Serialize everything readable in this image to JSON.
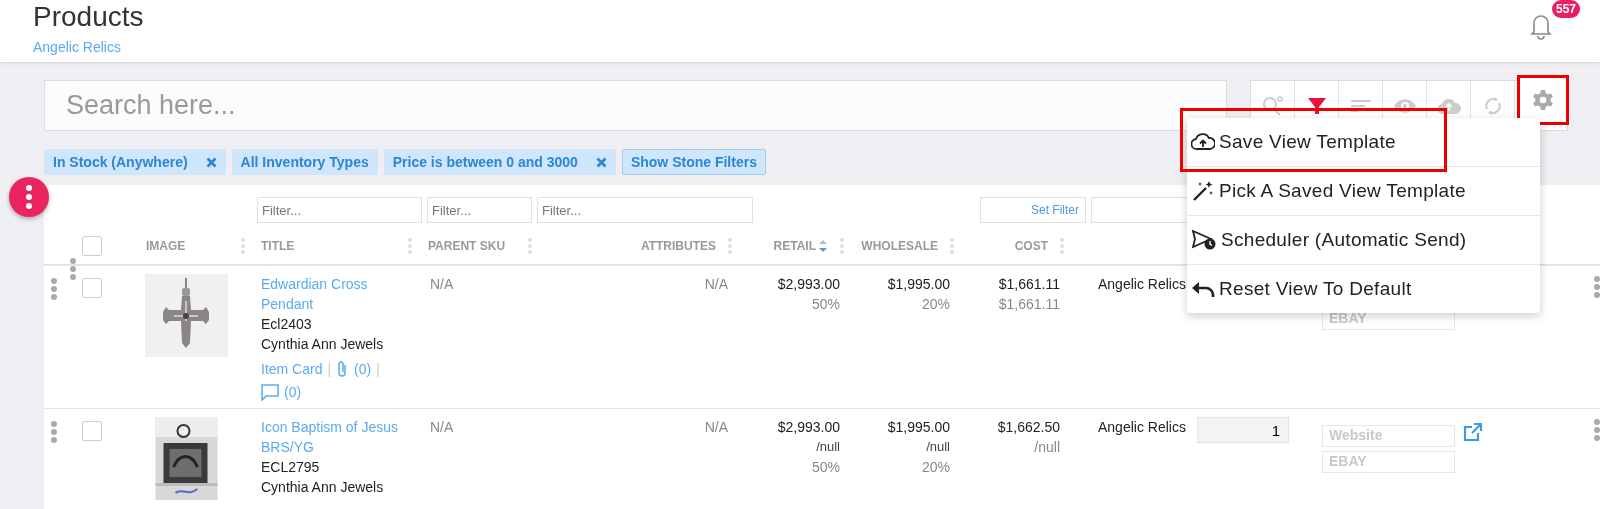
{
  "header": {
    "title": "Products",
    "subtitle": "Angelic Relics",
    "notification_count": "557"
  },
  "search": {
    "placeholder": "Search here..."
  },
  "toolbar": [
    {
      "kind": "search",
      "highlighted": false
    },
    {
      "kind": "filter",
      "highlighted": false
    },
    {
      "kind": "sort",
      "highlighted": false
    },
    {
      "kind": "eye",
      "highlighted": false
    },
    {
      "kind": "cloud",
      "highlighted": false
    },
    {
      "kind": "refresh",
      "highlighted": false
    },
    {
      "kind": "settings",
      "highlighted": true
    }
  ],
  "filter_chips": [
    {
      "label": "In Stock (Anywhere)",
      "removable": true
    },
    {
      "label": "All Inventory Types",
      "removable": false
    },
    {
      "label": "Price is between 0 and 3000",
      "removable": true
    },
    {
      "label": "Show Stone Filters",
      "removable": false
    }
  ],
  "table": {
    "filters": [
      {
        "placeholder": "Filter..."
      },
      {
        "placeholder": "Filter..."
      },
      {
        "placeholder": "Filter..."
      }
    ],
    "set_filter": "Set Filter",
    "select_all": {
      "checked": false
    },
    "columns": [
      {
        "label": "IMAGE",
        "sorted": false
      },
      {
        "label": "TITLE",
        "sorted": false
      },
      {
        "label": "PARENT SKU",
        "sorted": false
      },
      {
        "label": "ATTRIBUTES",
        "sorted": false
      },
      {
        "label": "RETAIL",
        "sorted": true
      },
      {
        "label": "WHOLESALE",
        "sorted": false
      },
      {
        "label": "COST",
        "sorted": false
      }
    ],
    "rows": [
      {
        "checked": false,
        "image": {
          "kind": "picture"
        },
        "title": "Edwardian Cross Pendant",
        "sku": "Ecl2403",
        "vendor": "Cynthia Ann Jewels",
        "item_card": "Item Card",
        "separators": [
          "|",
          "|"
        ],
        "attachments": "(0)",
        "comments": "(0)",
        "parent_sku": "N/A",
        "attributes": "N/A",
        "retail": [
          "$2,993.00",
          "50%"
        ],
        "wholesale": [
          "$1,995.00",
          "20%"
        ],
        "cost": [
          "$1,661.11",
          "$1,661.11"
        ],
        "location": "Angelic Relics",
        "channels": [
          "EBAY"
        ]
      },
      {
        "checked": false,
        "image": {
          "kind": "picture"
        },
        "title": "Icon Baptism of Jesus BRS/YG",
        "sku": "ECL2795",
        "vendor": "Cynthia Ann Jewels",
        "parent_sku": "N/A",
        "attributes": "N/A",
        "retail": [
          "$2,993.00",
          "/null",
          "50%"
        ],
        "wholesale": [
          "$1,995.00",
          "/null",
          "20%"
        ],
        "cost": [
          "$1,662.50",
          "/null"
        ],
        "location": "Angelic Relics",
        "quantity": "1",
        "channels": [
          "Website",
          "EBAY"
        ],
        "external_link": true
      }
    ]
  },
  "menu": [
    {
      "kind": "save",
      "label": "Save View Template",
      "highlighted": true
    },
    {
      "kind": "pick",
      "label": "Pick A Saved View Template",
      "highlighted": false
    },
    {
      "kind": "schedule",
      "label": "Scheduler (Automatic Send)",
      "highlighted": false
    },
    {
      "kind": "reset",
      "label": "Reset View To Default",
      "highlighted": false
    }
  ]
}
